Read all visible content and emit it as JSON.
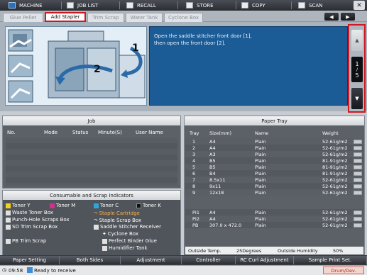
{
  "top_menu": {
    "items": [
      {
        "label": "MACHINE",
        "icon": "machine-icon"
      },
      {
        "label": "JOB LIST",
        "icon": "job-list-icon"
      },
      {
        "label": "RECALL",
        "icon": "recall-icon"
      },
      {
        "label": "STORE",
        "icon": "store-icon"
      },
      {
        "label": "COPY",
        "icon": "copy-icon"
      },
      {
        "label": "SCAN",
        "icon": "scan-icon"
      }
    ],
    "close_label": "✕"
  },
  "tabs": [
    {
      "label": "Glue Pellet"
    },
    {
      "label": "Add Stapler",
      "active": true
    },
    {
      "label": "Trim Scrap"
    },
    {
      "label": "Water Tank"
    },
    {
      "label": "Cyclone Box"
    }
  ],
  "guide": {
    "message_line1": "Open the saddle stitcher front door [1],",
    "message_line2": "then open the front door [2].",
    "step1": "1",
    "step2": "2",
    "page_current": "1",
    "page_total": "5"
  },
  "job_panel": {
    "title": "Job",
    "columns": [
      "No.",
      "Mode",
      "Status",
      "Minute(S)",
      "User Name"
    ]
  },
  "consumables": {
    "title": "Consumable and Scrap Indicators",
    "items": [
      {
        "label": "Toner Y",
        "icon": "toner-y-icon"
      },
      {
        "label": "Toner M",
        "icon": "toner-m-icon"
      },
      {
        "label": "Toner C",
        "icon": "toner-c-icon"
      },
      {
        "label": "Toner K",
        "icon": "toner-k-icon"
      },
      {
        "label": "Waste Toner Box",
        "icon": "waste-toner-icon"
      },
      {
        "label": "Staple Cartridge",
        "icon": "staple-cartridge-icon"
      },
      {
        "label": "Punch-Hole Scraps Box",
        "icon": "punch-hole-icon"
      },
      {
        "label": "Staple Scrap Box",
        "icon": "staple-scrap-icon"
      },
      {
        "label": "SD Trim Scrap Box",
        "icon": "sd-trim-icon"
      },
      {
        "label": "Saddle Stitcher Receiver",
        "icon": "saddle-receiver-icon"
      },
      {
        "label": "Cyclone Box",
        "icon": "cyclone-box-icon"
      },
      {
        "label": "PB Trim Scrap",
        "icon": "pb-trim-icon"
      },
      {
        "label": "Perfect Binder Glue",
        "icon": "binder-glue-icon"
      },
      {
        "label": "Humidifier Tank",
        "icon": "humidifier-icon"
      }
    ],
    "colors": {
      "toner_y": "#f2d21b",
      "toner_m": "#d0318c",
      "toner_c": "#2aa7dc",
      "toner_k": "#111111",
      "highlight": "#ffb040"
    }
  },
  "paper_tray": {
    "title": "Paper Tray",
    "columns": [
      "Tray",
      "Size(mm)",
      "Name",
      "Weight"
    ],
    "rows": [
      {
        "tray": "1",
        "size": "A4",
        "name": "Plain",
        "weight": "52-61g/m2"
      },
      {
        "tray": "2",
        "size": "A4",
        "name": "Plain",
        "weight": "52-61g/m2"
      },
      {
        "tray": "3",
        "size": "A3",
        "name": "Plain",
        "weight": "52-61g/m2"
      },
      {
        "tray": "4",
        "size": "B5",
        "name": "Plain",
        "weight": "81-91g/m2"
      },
      {
        "tray": "5",
        "size": "B5",
        "name": "Plain",
        "weight": "81-91g/m2"
      },
      {
        "tray": "6",
        "size": "B4",
        "name": "Plain",
        "weight": "81-91g/m2"
      },
      {
        "tray": "7",
        "size": "8.5x11",
        "name": "Plain",
        "weight": "52-61g/m2"
      },
      {
        "tray": "8",
        "size": "9x11",
        "name": "Plain",
        "weight": "52-61g/m2"
      },
      {
        "tray": "9",
        "size": "12x18",
        "name": "Plain",
        "weight": "52-61g/m2"
      },
      {
        "tray": "PI1",
        "size": "A4",
        "name": "Plain",
        "weight": "52-61g/m2"
      },
      {
        "tray": "PI2",
        "size": "A4",
        "name": "Plain",
        "weight": "52-61g/m2"
      },
      {
        "tray": "PB",
        "size": "307.0 x 472.0",
        "name": "Plain",
        "weight": "52-61g/m2"
      }
    ],
    "outside_temp_label": "Outside Temp.",
    "outside_temp_value": "25Degrees",
    "outside_humidity_label": "Outside Humidity",
    "outside_humidity_value": "50%"
  },
  "bottom_buttons": [
    "Paper Setting",
    "Both Sides",
    "Adjustment",
    "Controller",
    "RC Curl Adjustment",
    "Sample Print Set."
  ],
  "status": {
    "time": "09:58",
    "message": "Ready to receive",
    "badge": "Drum/Dev."
  }
}
